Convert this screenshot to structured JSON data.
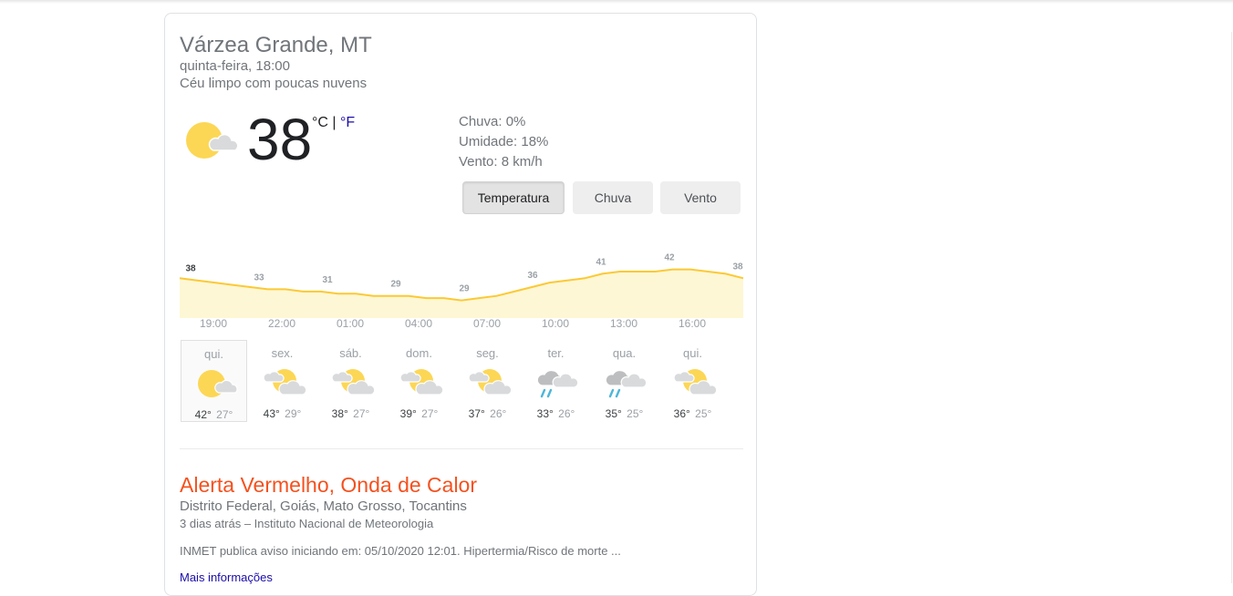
{
  "location": "Várzea Grande, MT",
  "datetime": "quinta-feira, 18:00",
  "condition": "Céu limpo com poucas nuvens",
  "current": {
    "temperature": "38",
    "unit_c": "°C",
    "unit_sep": " | ",
    "unit_f": "°F",
    "icon": "sun-behind-cloud-icon"
  },
  "details": {
    "rain": "Chuva: 0%",
    "humidity": "Umidade: 18%",
    "wind": "Vento: 8 km/h"
  },
  "tabs": [
    {
      "label": "Temperatura",
      "active": true
    },
    {
      "label": "Chuva",
      "active": false
    },
    {
      "label": "Vento",
      "active": false
    }
  ],
  "chart_data": {
    "type": "area",
    "x": [
      "19:00",
      "22:00",
      "01:00",
      "04:00",
      "07:00",
      "10:00",
      "13:00",
      "16:00"
    ],
    "labeled_values": [
      38,
      33,
      31,
      29,
      29,
      36,
      41,
      42,
      38
    ],
    "hourly_values": [
      38,
      37,
      36,
      35,
      34,
      33,
      33,
      32,
      32,
      31,
      31,
      30,
      30,
      30,
      29,
      29,
      28,
      29,
      30,
      32,
      34,
      36,
      37,
      38,
      40,
      41,
      41,
      41,
      42,
      42,
      41,
      40,
      38
    ],
    "color": "#fcc934",
    "fill": "#fef7d5"
  },
  "forecast": [
    {
      "day": "qui.",
      "hi": "42°",
      "lo": "27°",
      "icon": "sun-behind-cloud-icon",
      "selected": true
    },
    {
      "day": "sex.",
      "hi": "43°",
      "lo": "29°",
      "icon": "partly-cloudy-icon",
      "selected": false
    },
    {
      "day": "sáb.",
      "hi": "38°",
      "lo": "27°",
      "icon": "partly-cloudy-icon",
      "selected": false
    },
    {
      "day": "dom.",
      "hi": "39°",
      "lo": "27°",
      "icon": "partly-cloudy-icon",
      "selected": false
    },
    {
      "day": "seg.",
      "hi": "37°",
      "lo": "26°",
      "icon": "partly-cloudy-icon",
      "selected": false
    },
    {
      "day": "ter.",
      "hi": "33°",
      "lo": "26°",
      "icon": "rain-icon",
      "selected": false
    },
    {
      "day": "qua.",
      "hi": "35°",
      "lo": "25°",
      "icon": "rain-icon",
      "selected": false
    },
    {
      "day": "qui.",
      "hi": "36°",
      "lo": "25°",
      "icon": "partly-cloudy-icon",
      "selected": false
    }
  ],
  "alert": {
    "title": "Alerta Vermelho, Onda de Calor",
    "regions": "Distrito Federal, Goiás, Mato Grosso, Tocantins",
    "source": "3 dias atrás – Instituto Nacional de Meteorologia",
    "text": "INMET publica aviso iniciando em: 05/10/2020 12:01. Hipertermia/Risco de morte ...",
    "more": "Mais informações"
  },
  "colors": {
    "sun": "#fcd755",
    "cloud": "#d9dadc",
    "rain": "#4db6d9",
    "alert": "#f4511e",
    "link": "#1a0dab"
  }
}
